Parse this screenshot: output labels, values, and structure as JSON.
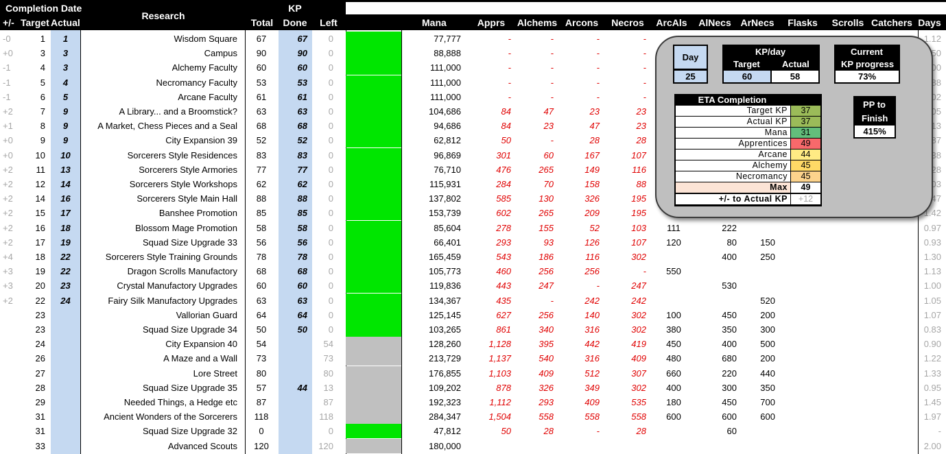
{
  "header": {
    "completion_date": "Completion Date",
    "plusminus": "+/-",
    "target": "Target",
    "actual": "Actual",
    "research": "Research",
    "total": "Total",
    "kp": "KP",
    "done": "Done",
    "left": "Left",
    "mana": "Mana",
    "apprs": "Apprs",
    "alchems": "Alchems",
    "arcons": "Arcons",
    "necros": "Necros",
    "arcals": "ArcAls",
    "alnecs": "AlNecs",
    "arnecs": "ArNecs",
    "flasks": "Flasks",
    "scrolls": "Scrolls",
    "catchers": "Catchers",
    "days": "Days"
  },
  "colors": {
    "bar_done": "#00e600",
    "bar_pending": "#c0c0c0",
    "done_col": "#c5d9f1",
    "red_values": "#e00000"
  },
  "rows": [
    {
      "pm": "-0",
      "target": "1",
      "actual": "1",
      "research": "Wisdom Square",
      "total": "67",
      "done": "67",
      "left": "0",
      "bar": "done",
      "mana": "77,777",
      "apprs": "-",
      "alchems": "-",
      "arcons": "-",
      "necros": "-",
      "arcals": "",
      "alnecs": "",
      "arnecs": "",
      "days": "1.12"
    },
    {
      "pm": "+0",
      "target": "3",
      "actual": "3",
      "research": "Campus",
      "total": "90",
      "done": "90",
      "left": "0",
      "bar": "done",
      "mana": "88,888",
      "apprs": "-",
      "alchems": "-",
      "arcons": "-",
      "necros": "-",
      "arcals": "",
      "alnecs": "",
      "arnecs": "",
      "days": "1.50"
    },
    {
      "pm": "-1",
      "target": "4",
      "actual": "3",
      "research": "Alchemy Faculty",
      "total": "60",
      "done": "60",
      "left": "0",
      "bar": "done",
      "mana": "111,000",
      "apprs": "-",
      "alchems": "-",
      "arcons": "-",
      "necros": "-",
      "arcals": "",
      "alnecs": "",
      "arnecs": "",
      "days": "1.00"
    },
    {
      "pm": "-1",
      "target": "5",
      "actual": "4",
      "research": "Necromancy Faculty",
      "total": "53",
      "done": "53",
      "left": "0",
      "bar": "done",
      "mana": "111,000",
      "apprs": "-",
      "alchems": "-",
      "arcons": "-",
      "necros": "-",
      "arcals": "",
      "alnecs": "",
      "arnecs": "",
      "days": "0.88"
    },
    {
      "pm": "-1",
      "target": "6",
      "actual": "5",
      "research": "Arcane Faculty",
      "total": "61",
      "done": "61",
      "left": "0",
      "bar": "done",
      "mana": "111,000",
      "apprs": "-",
      "alchems": "-",
      "arcons": "-",
      "necros": "-",
      "arcals": "",
      "alnecs": "",
      "arnecs": "",
      "days": "1.02"
    },
    {
      "pm": "+2",
      "target": "7",
      "actual": "9",
      "research": "A Library... and a Broomstick?",
      "total": "63",
      "done": "63",
      "left": "0",
      "bar": "done",
      "mana": "104,686",
      "apprs": "84",
      "alchems": "47",
      "arcons": "23",
      "necros": "23",
      "arcals": "",
      "alnecs": "",
      "arnecs": "",
      "days": "1.05"
    },
    {
      "pm": "+1",
      "target": "8",
      "actual": "9",
      "research": "A Market, Chess Pieces and a Seal",
      "total": "68",
      "done": "68",
      "left": "0",
      "bar": "done",
      "mana": "94,686",
      "apprs": "84",
      "alchems": "23",
      "arcons": "47",
      "necros": "23",
      "arcals": "",
      "alnecs": "",
      "arnecs": "",
      "days": "1.13"
    },
    {
      "pm": "+0",
      "target": "9",
      "actual": "9",
      "research": "City Expansion 39",
      "total": "52",
      "done": "52",
      "left": "0",
      "bar": "done",
      "mana": "62,812",
      "apprs": "50",
      "alchems": "-",
      "arcons": "28",
      "necros": "28",
      "arcals": "",
      "alnecs": "",
      "arnecs": "",
      "days": "0.87"
    },
    {
      "pm": "+0",
      "target": "10",
      "actual": "10",
      "research": "Sorcerers Style Residences",
      "total": "83",
      "done": "83",
      "left": "0",
      "bar": "done",
      "mana": "96,869",
      "apprs": "301",
      "alchems": "60",
      "arcons": "167",
      "necros": "107",
      "arcals": "",
      "alnecs": "",
      "arnecs": "",
      "days": "1.38"
    },
    {
      "pm": "+2",
      "target": "11",
      "actual": "13",
      "research": "Sorcerers Style Armories",
      "total": "77",
      "done": "77",
      "left": "0",
      "bar": "done",
      "mana": "76,710",
      "apprs": "476",
      "alchems": "265",
      "arcons": "149",
      "necros": "116",
      "arcals": "",
      "alnecs": "",
      "arnecs": "",
      "days": "1.28"
    },
    {
      "pm": "+2",
      "target": "12",
      "actual": "14",
      "research": "Sorcerers Style Workshops",
      "total": "62",
      "done": "62",
      "left": "0",
      "bar": "done",
      "mana": "115,931",
      "apprs": "284",
      "alchems": "70",
      "arcons": "158",
      "necros": "88",
      "arcals": "",
      "alnecs": "",
      "arnecs": "",
      "days": "1.03"
    },
    {
      "pm": "+2",
      "target": "14",
      "actual": "16",
      "research": "Sorcerers Style Main Hall",
      "total": "88",
      "done": "88",
      "left": "0",
      "bar": "done",
      "mana": "137,802",
      "apprs": "585",
      "alchems": "130",
      "arcons": "326",
      "necros": "195",
      "arcals": "",
      "alnecs": "",
      "arnecs": "",
      "days": "1.47"
    },
    {
      "pm": "+2",
      "target": "15",
      "actual": "17",
      "research": "Banshee Promotion",
      "total": "85",
      "done": "85",
      "left": "0",
      "bar": "done",
      "mana": "153,739",
      "apprs": "602",
      "alchems": "265",
      "arcons": "209",
      "necros": "195",
      "arcals": "",
      "alnecs": "",
      "arnecs": "",
      "days": "1.42"
    },
    {
      "pm": "+2",
      "target": "16",
      "actual": "18",
      "research": "Blossom Mage Promotion",
      "total": "58",
      "done": "58",
      "left": "0",
      "bar": "done",
      "mana": "85,604",
      "apprs": "278",
      "alchems": "155",
      "arcons": "52",
      "necros": "103",
      "arcals": "111",
      "alnecs": "222",
      "arnecs": "",
      "days": "0.97"
    },
    {
      "pm": "+2",
      "target": "17",
      "actual": "19",
      "research": "Squad Size Upgrade 33",
      "total": "56",
      "done": "56",
      "left": "0",
      "bar": "done",
      "mana": "66,401",
      "apprs": "293",
      "alchems": "93",
      "arcons": "126",
      "necros": "107",
      "arcals": "120",
      "alnecs": "80",
      "arnecs": "150",
      "days": "0.93"
    },
    {
      "pm": "+4",
      "target": "18",
      "actual": "22",
      "research": "Sorcerers Style Training Grounds",
      "total": "78",
      "done": "78",
      "left": "0",
      "bar": "done",
      "mana": "165,459",
      "apprs": "543",
      "alchems": "186",
      "arcons": "116",
      "necros": "302",
      "arcals": "",
      "alnecs": "400",
      "arnecs": "250",
      "days": "1.30"
    },
    {
      "pm": "+3",
      "target": "19",
      "actual": "22",
      "research": "Dragon Scrolls Manufactory",
      "total": "68",
      "done": "68",
      "left": "0",
      "bar": "done",
      "mana": "105,773",
      "apprs": "460",
      "alchems": "256",
      "arcons": "256",
      "necros": "-",
      "arcals": "550",
      "alnecs": "",
      "arnecs": "",
      "days": "1.13"
    },
    {
      "pm": "+3",
      "target": "20",
      "actual": "23",
      "research": "Crystal Manufactory Upgrades",
      "total": "60",
      "done": "60",
      "left": "0",
      "bar": "done",
      "mana": "119,836",
      "apprs": "443",
      "alchems": "247",
      "arcons": "-",
      "necros": "247",
      "arcals": "",
      "alnecs": "530",
      "arnecs": "",
      "days": "1.00"
    },
    {
      "pm": "+2",
      "target": "22",
      "actual": "24",
      "research": "Fairy Silk Manufactory Upgrades",
      "total": "63",
      "done": "63",
      "left": "0",
      "bar": "done",
      "mana": "134,367",
      "apprs": "435",
      "alchems": "-",
      "arcons": "242",
      "necros": "242",
      "arcals": "",
      "alnecs": "",
      "arnecs": "520",
      "days": "1.05"
    },
    {
      "pm": "",
      "target": "23",
      "actual": "",
      "research": "Vallorian Guard",
      "total": "64",
      "done": "64",
      "left": "0",
      "bar": "done",
      "mana": "125,145",
      "apprs": "627",
      "alchems": "256",
      "arcons": "140",
      "necros": "302",
      "arcals": "100",
      "alnecs": "450",
      "arnecs": "200",
      "days": "1.07"
    },
    {
      "pm": "",
      "target": "23",
      "actual": "",
      "research": "Squad Size Upgrade 34",
      "total": "50",
      "done": "50",
      "left": "0",
      "bar": "done",
      "mana": "103,265",
      "apprs": "861",
      "alchems": "340",
      "arcons": "316",
      "necros": "302",
      "arcals": "380",
      "alnecs": "350",
      "arnecs": "300",
      "days": "0.83"
    },
    {
      "pm": "",
      "target": "24",
      "actual": "",
      "research": "City Expansion 40",
      "total": "54",
      "done": "",
      "left": "54",
      "bar": "pending",
      "mana": "128,260",
      "apprs": "1,128",
      "alchems": "395",
      "arcons": "442",
      "necros": "419",
      "arcals": "450",
      "alnecs": "400",
      "arnecs": "500",
      "days": "0.90"
    },
    {
      "pm": "",
      "target": "26",
      "actual": "",
      "research": "A Maze and a Wall",
      "total": "73",
      "done": "",
      "left": "73",
      "bar": "pending",
      "mana": "213,729",
      "apprs": "1,137",
      "alchems": "540",
      "arcons": "316",
      "necros": "409",
      "arcals": "480",
      "alnecs": "680",
      "arnecs": "200",
      "days": "1.22"
    },
    {
      "pm": "",
      "target": "27",
      "actual": "",
      "research": "Lore Street",
      "total": "80",
      "done": "",
      "left": "80",
      "bar": "pending",
      "mana": "176,855",
      "apprs": "1,103",
      "alchems": "409",
      "arcons": "512",
      "necros": "307",
      "arcals": "660",
      "alnecs": "220",
      "arnecs": "440",
      "days": "1.33"
    },
    {
      "pm": "",
      "target": "28",
      "actual": "",
      "research": "Squad Size Upgrade 35",
      "total": "57",
      "done": "44",
      "left": "13",
      "bar": "pending",
      "mana": "109,202",
      "apprs": "878",
      "alchems": "326",
      "arcons": "349",
      "necros": "302",
      "arcals": "400",
      "alnecs": "300",
      "arnecs": "350",
      "days": "0.95"
    },
    {
      "pm": "",
      "target": "29",
      "actual": "",
      "research": "Needed Things, a Hedge etc",
      "total": "87",
      "done": "",
      "left": "87",
      "bar": "pending",
      "mana": "192,323",
      "apprs": "1,112",
      "alchems": "293",
      "arcons": "409",
      "necros": "535",
      "arcals": "180",
      "alnecs": "450",
      "arnecs": "700",
      "days": "1.45"
    },
    {
      "pm": "",
      "target": "31",
      "actual": "",
      "research": "Ancient Wonders of the Sorcerers",
      "total": "118",
      "done": "",
      "left": "118",
      "bar": "pending",
      "mana": "284,347",
      "apprs": "1,504",
      "alchems": "558",
      "arcons": "558",
      "necros": "558",
      "arcals": "600",
      "alnecs": "600",
      "arnecs": "600",
      "days": "1.97"
    },
    {
      "pm": "",
      "target": "31",
      "actual": "",
      "research": "Squad Size Upgrade 32",
      "total": "0",
      "done": "",
      "left": "0",
      "bar": "done",
      "mana": "47,812",
      "apprs": "50",
      "alchems": "28",
      "arcons": "-",
      "necros": "28",
      "arcals": "",
      "alnecs": "60",
      "arnecs": "",
      "days": "-"
    },
    {
      "pm": "",
      "target": "33",
      "actual": "",
      "research": "Advanced Scouts",
      "total": "120",
      "done": "",
      "left": "120",
      "bar": "pending",
      "mana": "180,000",
      "apprs": "",
      "alchems": "",
      "arcons": "",
      "necros": "",
      "arcals": "",
      "alnecs": "",
      "arnecs": "",
      "days": "2.00"
    }
  ],
  "panel": {
    "day_label": "Day",
    "day_value": "25",
    "kpday_label": "KP/day",
    "kpday_target_label": "Target",
    "kpday_actual_label": "Actual",
    "kpday_target": "60",
    "kpday_actual": "58",
    "current_label_1": "Current",
    "current_label_2": "KP progress",
    "current_value": "73%",
    "pp_label_1": "PP to",
    "pp_label_2": "Finish",
    "pp_value": "415%",
    "eta_title": "ETA Completion",
    "eta": [
      {
        "label": "Target KP",
        "value": "37",
        "color": "#9bbb59"
      },
      {
        "label": "Actual KP",
        "value": "37",
        "color": "#9bbb59"
      },
      {
        "label": "Mana",
        "value": "31",
        "color": "#63be7b"
      },
      {
        "label": "Apprentices",
        "value": "49",
        "color": "#f8696b"
      },
      {
        "label": "Arcane",
        "value": "44",
        "color": "#ffeb84"
      },
      {
        "label": "Alchemy",
        "value": "45",
        "color": "#ffd966"
      },
      {
        "label": "Necromancy",
        "value": "45",
        "color": "#fcd38c"
      }
    ],
    "max_label": "Max",
    "max_value": "49",
    "diff_label": "+/- to Actual KP",
    "diff_value": "+12"
  }
}
